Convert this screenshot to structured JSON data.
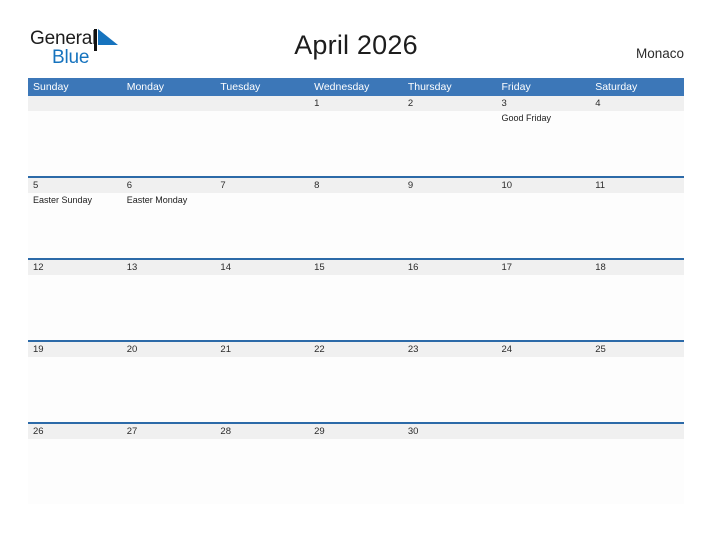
{
  "brand": {
    "name_part1": "General",
    "name_part2": "Blue",
    "logo_icon": "blue-triangle-flag-icon",
    "accent_color": "#1673be"
  },
  "header": {
    "title": "April 2026",
    "location": "Monaco"
  },
  "colors": {
    "header_blue": "#3c77b8",
    "row_divider_blue": "#2c6aa8",
    "date_band_gray": "#f0f0f0",
    "text_dark": "#1d1d1d"
  },
  "calendar": {
    "month": "April",
    "year": "2026",
    "weekday_headers": [
      "Sunday",
      "Monday",
      "Tuesday",
      "Wednesday",
      "Thursday",
      "Friday",
      "Saturday"
    ],
    "weeks": [
      {
        "days": [
          {
            "num": "",
            "events": []
          },
          {
            "num": "",
            "events": []
          },
          {
            "num": "",
            "events": []
          },
          {
            "num": "1",
            "events": []
          },
          {
            "num": "2",
            "events": []
          },
          {
            "num": "3",
            "events": [
              "Good Friday"
            ]
          },
          {
            "num": "4",
            "events": []
          }
        ]
      },
      {
        "days": [
          {
            "num": "5",
            "events": [
              "Easter Sunday"
            ]
          },
          {
            "num": "6",
            "events": [
              "Easter Monday"
            ]
          },
          {
            "num": "7",
            "events": []
          },
          {
            "num": "8",
            "events": []
          },
          {
            "num": "9",
            "events": []
          },
          {
            "num": "10",
            "events": []
          },
          {
            "num": "11",
            "events": []
          }
        ]
      },
      {
        "days": [
          {
            "num": "12",
            "events": []
          },
          {
            "num": "13",
            "events": []
          },
          {
            "num": "14",
            "events": []
          },
          {
            "num": "15",
            "events": []
          },
          {
            "num": "16",
            "events": []
          },
          {
            "num": "17",
            "events": []
          },
          {
            "num": "18",
            "events": []
          }
        ]
      },
      {
        "days": [
          {
            "num": "19",
            "events": []
          },
          {
            "num": "20",
            "events": []
          },
          {
            "num": "21",
            "events": []
          },
          {
            "num": "22",
            "events": []
          },
          {
            "num": "23",
            "events": []
          },
          {
            "num": "24",
            "events": []
          },
          {
            "num": "25",
            "events": []
          }
        ]
      },
      {
        "days": [
          {
            "num": "26",
            "events": []
          },
          {
            "num": "27",
            "events": []
          },
          {
            "num": "28",
            "events": []
          },
          {
            "num": "29",
            "events": []
          },
          {
            "num": "30",
            "events": []
          },
          {
            "num": "",
            "events": []
          },
          {
            "num": "",
            "events": []
          }
        ]
      }
    ]
  }
}
